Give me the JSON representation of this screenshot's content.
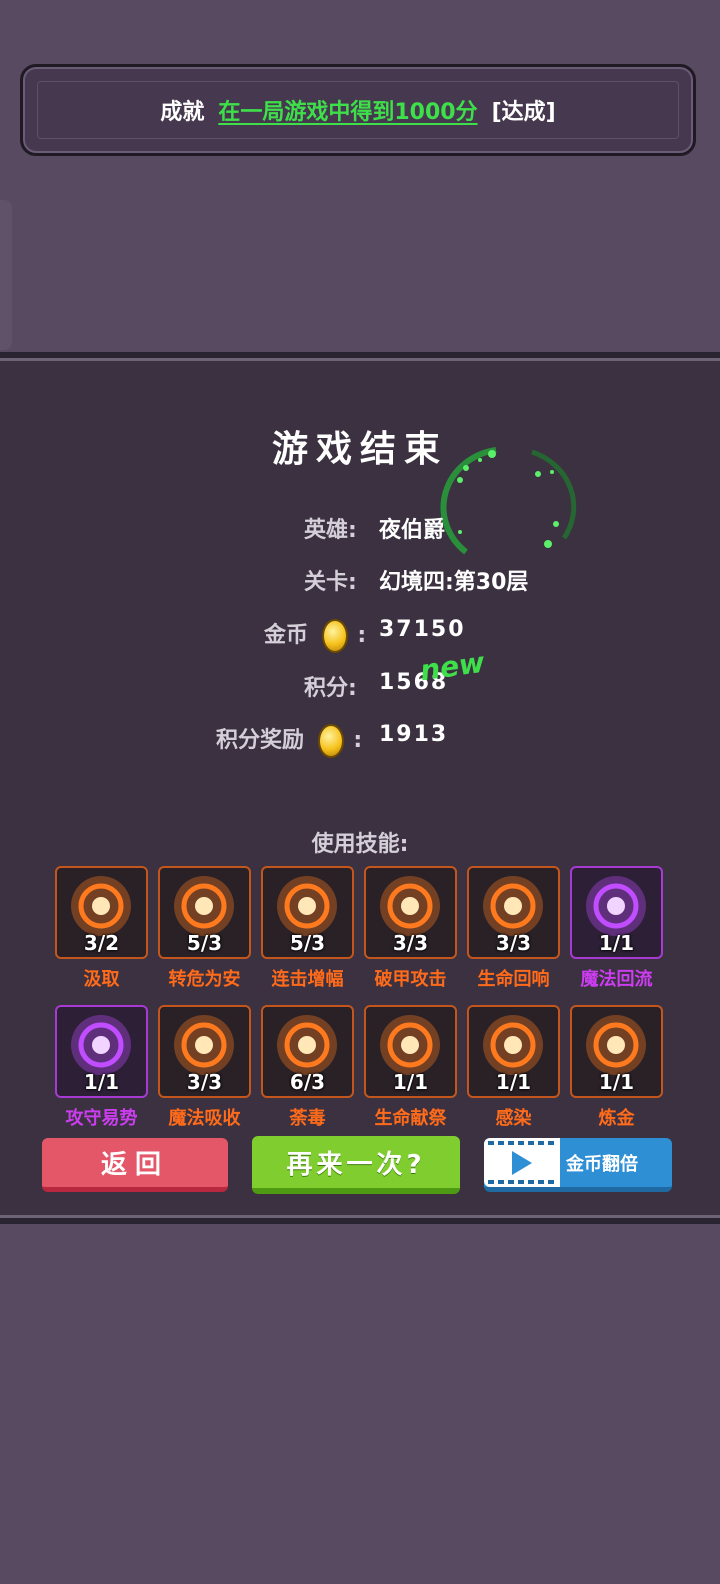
{
  "achievement": {
    "label": "成就",
    "goal": "在一局游戏中得到1000分",
    "status": "[达成]"
  },
  "result": {
    "title": "游戏结束",
    "hero_label": "英雄:",
    "hero_value": "夜伯爵",
    "stage_label": "关卡:",
    "stage_value": "幻境四:第30层",
    "gold_label": "金币",
    "gold_colon": ":",
    "gold_value": "37150",
    "score_label": "积分:",
    "score_value": "1568",
    "new_tag": "new",
    "bonus_label": "积分奖励",
    "bonus_colon": ":",
    "bonus_value": "1913"
  },
  "skills_title": "使用技能:",
  "skills": [
    {
      "name": "汲取",
      "count": "3/2",
      "color": "orange",
      "icon": "heal-cross-icon"
    },
    {
      "name": "转危为安",
      "count": "5/3",
      "color": "orange",
      "icon": "sparkle-heal-icon"
    },
    {
      "name": "连击增幅",
      "count": "5/3",
      "color": "orange",
      "icon": "combo-figure-icon"
    },
    {
      "name": "破甲攻击",
      "count": "3/3",
      "color": "orange",
      "icon": "armor-break-icon"
    },
    {
      "name": "生命回响",
      "count": "3/3",
      "color": "orange",
      "icon": "muscle-arm-icon"
    },
    {
      "name": "魔法回流",
      "count": "1/1",
      "color": "purple",
      "icon": "magic-crystal-icon"
    },
    {
      "name": "攻守易势",
      "count": "1/1",
      "color": "purple",
      "icon": "shield-gear-icon"
    },
    {
      "name": "魔法吸收",
      "count": "3/3",
      "color": "orange",
      "icon": "caduceus-icon"
    },
    {
      "name": "荼毒",
      "count": "6/3",
      "color": "orange",
      "icon": "poison-blade-icon"
    },
    {
      "name": "生命献祭",
      "count": "1/1",
      "color": "orange",
      "icon": "fire-altar-icon"
    },
    {
      "name": "感染",
      "count": "1/1",
      "color": "orange",
      "icon": "splash-icon"
    },
    {
      "name": "炼金",
      "count": "1/1",
      "color": "orange",
      "icon": "target-gear-icon"
    }
  ],
  "buttons": {
    "back": "返回",
    "retry": "再来一次?",
    "double": "金币翻倍"
  },
  "colors": {
    "background": "#574a61",
    "panel": "#3b3140",
    "accent_green": "#3ee04a",
    "skill_orange": "#ff6b1a",
    "skill_purple": "#cc3df0"
  }
}
